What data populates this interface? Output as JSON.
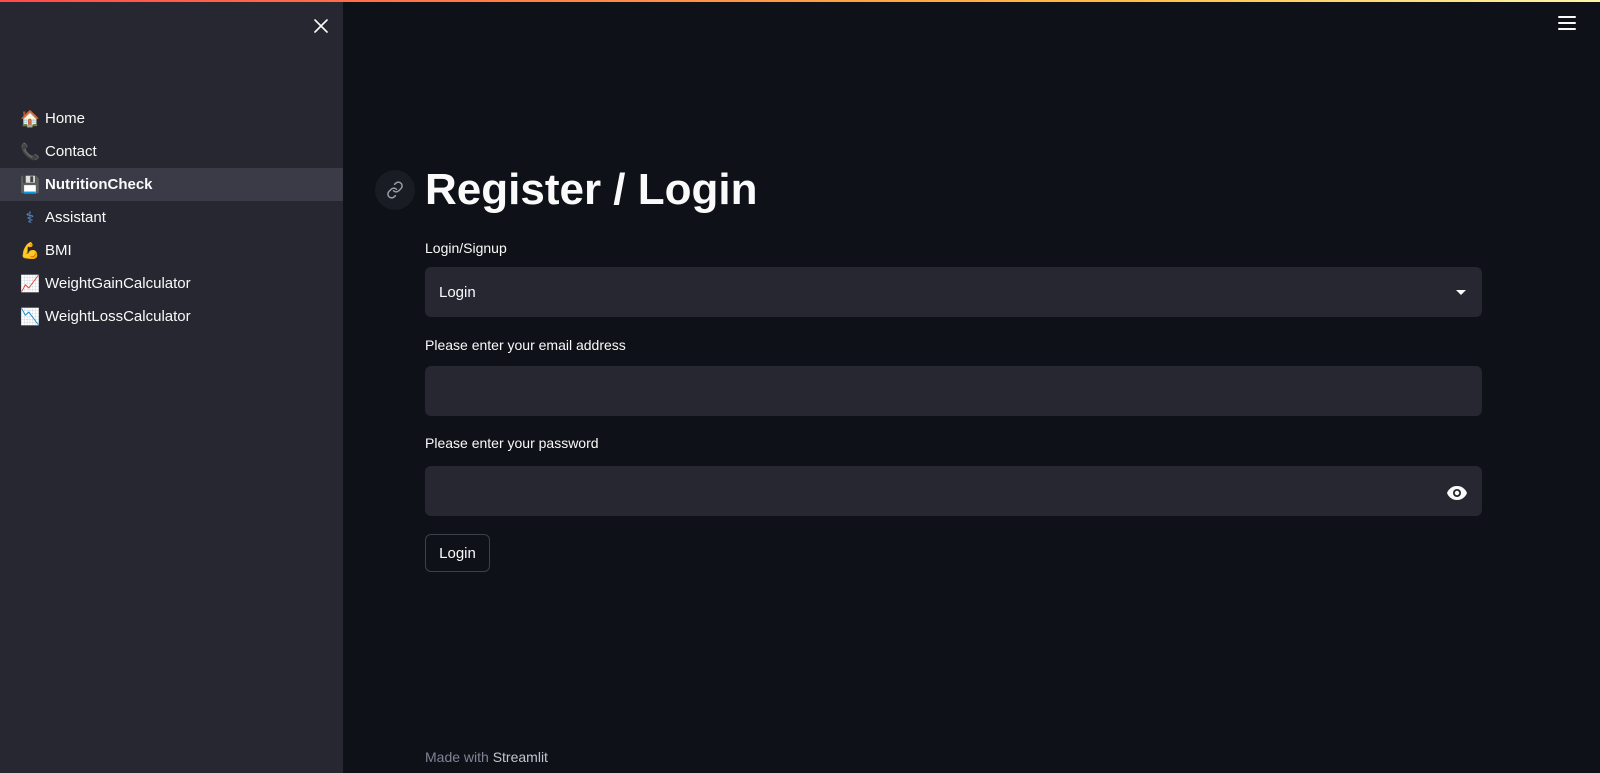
{
  "sidebar": {
    "items": [
      {
        "icon": "house-icon",
        "glyph": "🏠",
        "label": "Home"
      },
      {
        "icon": "phone-icon",
        "glyph": "📞",
        "label": "Contact"
      },
      {
        "icon": "floppy-disk-icon",
        "glyph": "💾",
        "label": "NutritionCheck",
        "active": true
      },
      {
        "icon": "stethoscope-icon",
        "glyph": "⚕",
        "label": "Assistant"
      },
      {
        "icon": "flexed-bicep-icon",
        "glyph": "💪",
        "label": "BMI"
      },
      {
        "icon": "chart-increasing-icon",
        "glyph": "📈",
        "label": "WeightGainCalculator"
      },
      {
        "icon": "chart-decreasing-icon",
        "glyph": "📉",
        "label": "WeightLossCalculator"
      }
    ]
  },
  "main": {
    "title": "Register / Login",
    "mode": {
      "label": "Login/Signup",
      "selected": "Login"
    },
    "email": {
      "label": "Please enter your email address",
      "value": ""
    },
    "password": {
      "label": "Please enter your password",
      "value": ""
    },
    "submit_label": "Login"
  },
  "footer": {
    "prefix": "Made with",
    "brand": "Streamlit"
  },
  "colors": {
    "background": "#0e1117",
    "sidebar": "#262730",
    "input": "#262730",
    "active_nav": "#3a3b47",
    "accent": "#ff4b4b"
  }
}
